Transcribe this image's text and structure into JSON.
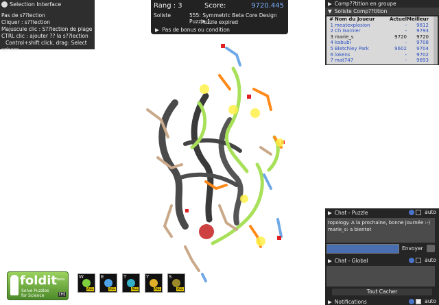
{
  "selection": {
    "title": "Selection Interface",
    "lines": [
      "Pas de s??lection",
      "Cliquer : s??lection",
      "Majuscule clic : S??lection de plage",
      "CTRL clic : ajouter ?? la s??lection",
      "Control+shift click, drag: Select",
      "sphere"
    ]
  },
  "score": {
    "rank": "Rang : 3",
    "score_label": "Score:",
    "score_value": "9720.445",
    "mode": "Soliste",
    "puzzle": "555: Symmetric Beta Core Design Puzzle 1",
    "status": "Puzzle expired",
    "bonus": "Pas de bonus ou condition"
  },
  "competition": {
    "group_header": "Comp??tition en groupe",
    "solo_header": "Soliste Comp??tition",
    "columns": [
      "#",
      "Nom du Joueur",
      "Actuel",
      "Meilleur"
    ],
    "rows": [
      {
        "n": "1",
        "name": "meatexplosion",
        "cur": "-",
        "best": "9812"
      },
      {
        "n": "2",
        "name": "Ch Garnier",
        "cur": "-",
        "best": "9793"
      },
      {
        "n": "3",
        "name": "marie_s",
        "cur": "9720",
        "best": "9720"
      },
      {
        "n": "4",
        "name": "kabubi",
        "cur": "-",
        "best": "9708"
      },
      {
        "n": "5",
        "name": "Bletchley Park",
        "cur": "9602",
        "best": "9704"
      },
      {
        "n": "6",
        "name": "lokens",
        "cur": "-",
        "best": "9702"
      },
      {
        "n": "7",
        "name": "mat747",
        "cur": "-",
        "best": "9693"
      }
    ]
  },
  "chat": {
    "puzzle_header": "Chat - Puzzle",
    "auto_label": "auto",
    "log": [
      "topology. A la prochaine, bonne journée :-)",
      "marie_s: a bientot"
    ],
    "input_value": "",
    "send_label": "Envoyer",
    "global_header": "Chat - Global",
    "hide_label": "Tout Cacher",
    "notifications_header": "Notifications"
  },
  "logo": {
    "brand": "foldit",
    "beta": "beta",
    "tagline1": "Solve Puzzles",
    "tagline2": "for Science",
    "help_key": "[H]"
  },
  "tools": [
    {
      "key": "W",
      "all": "ALL",
      "color": "#7fcf3f"
    },
    {
      "key": "E",
      "all": "ALL",
      "color": "#4da3e6"
    },
    {
      "key": "T",
      "all": "ALL",
      "color": "#35b0c8"
    },
    {
      "key": "Y",
      "all": "ALL",
      "color": "#e0b02a"
    },
    {
      "key": "S",
      "all": "ALL",
      "color": "#9c8a2a"
    }
  ]
}
